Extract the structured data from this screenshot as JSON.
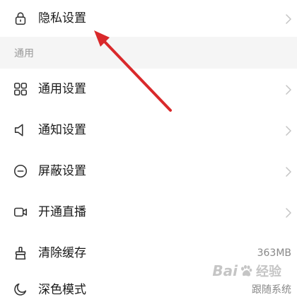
{
  "privacy": {
    "label": "隐私设置",
    "icon": "lock-icon",
    "has_chevron": true
  },
  "section": {
    "title": "通用"
  },
  "rows": [
    {
      "label": "通用设置",
      "icon": "grid-icon",
      "has_chevron": true
    },
    {
      "label": "通知设置",
      "icon": "speaker-icon",
      "has_chevron": true
    },
    {
      "label": "屏蔽设置",
      "icon": "minus-circle-icon",
      "has_chevron": true
    },
    {
      "label": "开通直播",
      "icon": "video-camera-icon",
      "has_chevron": true
    },
    {
      "label": "清除缓存",
      "icon": "broom-icon",
      "value": "363MB"
    },
    {
      "label": "深色模式",
      "icon": "moon-icon",
      "value": "跟随系统"
    }
  ],
  "watermark": {
    "brand": "Bai",
    "product": "经验"
  },
  "colors": {
    "text": "#1a1a1a",
    "section_bg": "#f5f5f5",
    "section_text": "#999999",
    "chevron": "#c4c4c4",
    "value_text": "#888888",
    "annotation_arrow": "#d9292b"
  }
}
